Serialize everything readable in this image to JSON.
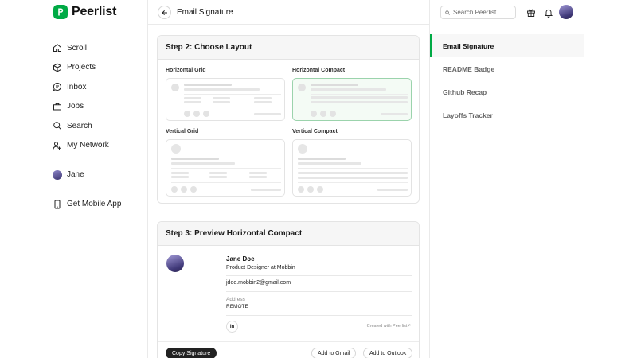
{
  "brand": {
    "name": "Peerlist",
    "color": "#00aa45",
    "logo_letter": "P"
  },
  "sidebar": {
    "items": [
      {
        "label": "Scroll",
        "icon": "home-icon"
      },
      {
        "label": "Projects",
        "icon": "cube-icon"
      },
      {
        "label": "Inbox",
        "icon": "chat-icon"
      },
      {
        "label": "Jobs",
        "icon": "briefcase-icon"
      },
      {
        "label": "Search",
        "icon": "search-icon"
      },
      {
        "label": "My Network",
        "icon": "network-icon"
      }
    ],
    "profile": {
      "label": "Jane"
    },
    "mobile": {
      "label": "Get Mobile App",
      "icon": "phone-icon"
    }
  },
  "header": {
    "title": "Email Signature",
    "search_placeholder": "Search Peerlist"
  },
  "right_nav": {
    "items": [
      {
        "label": "Email Signature",
        "active": true
      },
      {
        "label": "README Badge",
        "active": false
      },
      {
        "label": "Github Recap",
        "active": false
      },
      {
        "label": "Layoffs Tracker",
        "active": false
      }
    ]
  },
  "step2": {
    "title": "Step 2: Choose Layout",
    "layouts": [
      {
        "label": "Horizontal Grid",
        "selected": false
      },
      {
        "label": "Horizontal Compact",
        "selected": true
      },
      {
        "label": "Vertical Grid",
        "selected": false
      },
      {
        "label": "Vertical Compact",
        "selected": false
      }
    ]
  },
  "step3": {
    "title": "Step 3: Preview Horizontal Compact",
    "signature": {
      "name": "Jane Doe",
      "role": "Product Designer at Mobbin",
      "email": "jdoe.mobbin2@gmail.com",
      "address_label": "Address",
      "address_value": "REMOTE",
      "linkedin": "in",
      "created_with": "Created with Peerlist↗"
    },
    "buttons": {
      "copy": "Copy Signature",
      "gmail": "Add to Gmail",
      "outlook": "Add to Outlook"
    }
  }
}
